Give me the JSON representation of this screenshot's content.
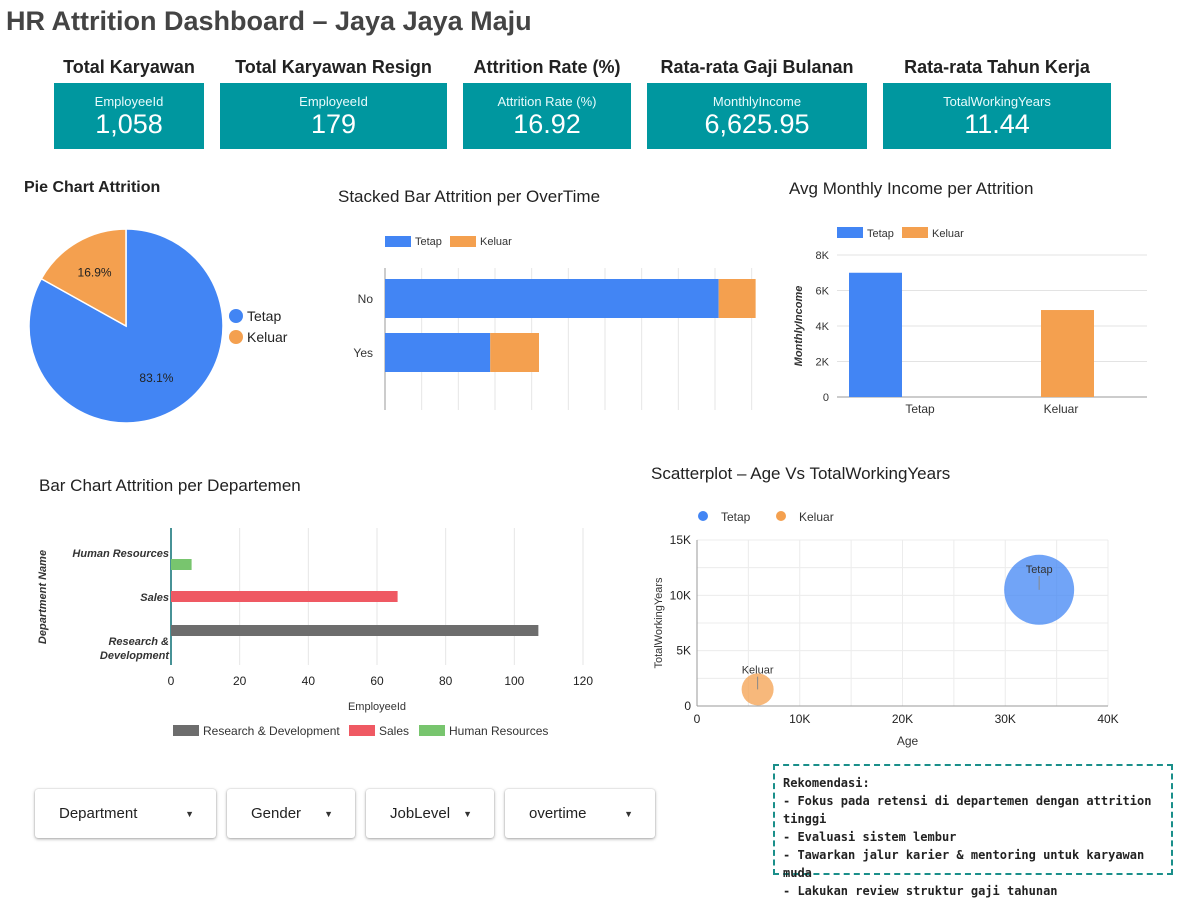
{
  "page_title": "HR Attrition Dashboard – Jaya Jaya Maju",
  "kpis": [
    {
      "heading": "Total Karyawan",
      "label": "EmployeeId",
      "value": "1,058"
    },
    {
      "heading": "Total Karyawan Resign",
      "label": "EmployeeId",
      "value": "179"
    },
    {
      "heading": "Attrition Rate (%)",
      "label": "Attrition Rate (%)",
      "value": "16.92"
    },
    {
      "heading": "Rata-rata Gaji Bulanan",
      "label": "MonthlyIncome",
      "value": "6,625.95"
    },
    {
      "heading": "Rata-rata Tahun Kerja",
      "label": "TotalWorkingYears",
      "value": "11.44"
    }
  ],
  "colors": {
    "tetap": "#4285f4",
    "keluar": "#f4a04f",
    "rnd": "#6d6d6d",
    "sales": "#ef5963",
    "hr": "#78c56e",
    "kpi": "#00979f"
  },
  "chart_data": [
    {
      "id": "pie",
      "type": "pie",
      "title": "Pie Chart Attrition",
      "labels": [
        "Tetap",
        "Keluar"
      ],
      "values": [
        83.1,
        16.9
      ],
      "data_labels": [
        "83.1%",
        "16.9%"
      ],
      "legend": "right"
    },
    {
      "id": "stacked",
      "type": "bar",
      "orientation": "horizontal",
      "stacked": true,
      "title": "Stacked Bar Attrition per OverTime",
      "categories": [
        "No",
        "Yes"
      ],
      "series": [
        {
          "name": "Tetap",
          "values": [
            650,
            205
          ]
        },
        {
          "name": "Keluar",
          "values": [
            72,
            95
          ]
        }
      ],
      "xlim": [
        0,
        750
      ],
      "legend": "top"
    },
    {
      "id": "income",
      "type": "bar",
      "title": "Avg Monthly Income per Attrition",
      "categories": [
        "Tetap",
        "Keluar"
      ],
      "series": [
        {
          "name": "Tetap",
          "values": [
            7000,
            null
          ]
        },
        {
          "name": "Keluar",
          "values": [
            null,
            4900
          ]
        }
      ],
      "ylabel": "MonthlyIncome",
      "ylim": [
        0,
        8000
      ],
      "y_ticks": [
        "0",
        "2K",
        "4K",
        "6K",
        "8K"
      ],
      "legend": "top"
    },
    {
      "id": "dept",
      "type": "bar",
      "orientation": "horizontal",
      "title": "Bar Chart Attrition per Departemen",
      "categories": [
        "Human Resources",
        "Sales",
        "Research & Development"
      ],
      "values": [
        6,
        66,
        107
      ],
      "xlabel": "EmployeeId",
      "ylabel": "Department Name",
      "xlim": [
        0,
        130
      ],
      "x_ticks": [
        "0",
        "20",
        "40",
        "60",
        "80",
        "100",
        "120"
      ],
      "legend_entries": [
        "Research & Development",
        "Sales",
        "Human Resources"
      ],
      "legend": "bottom"
    },
    {
      "id": "scatter",
      "type": "scatter",
      "title": "Scatterplot – Age Vs TotalWorkingYears",
      "series": [
        {
          "name": "Tetap",
          "x": 33300,
          "y": 10500,
          "label": "Tetap"
        },
        {
          "name": "Keluar",
          "x": 5900,
          "y": 1500,
          "label": "Keluar"
        }
      ],
      "xlabel": "Age",
      "ylabel": "TotalWorkingYears",
      "xlim": [
        0,
        40000
      ],
      "ylim": [
        0,
        15000
      ],
      "x_ticks": [
        "0",
        "10K",
        "20K",
        "30K",
        "40K"
      ],
      "y_ticks": [
        "0",
        "5K",
        "10K",
        "15K"
      ],
      "legend": "top"
    }
  ],
  "filters": [
    {
      "label": "Department"
    },
    {
      "label": "Gender"
    },
    {
      "label": "JobLevel"
    },
    {
      "label": "overtime"
    }
  ],
  "recommendation": {
    "heading": "Rekomendasi:",
    "items": [
      "- Fokus pada retensi di departemen dengan attrition tinggi",
      "- Evaluasi sistem lembur",
      "- Tawarkan jalur karier & mentoring untuk karyawan muda",
      "- Lakukan review struktur gaji tahunan"
    ]
  }
}
